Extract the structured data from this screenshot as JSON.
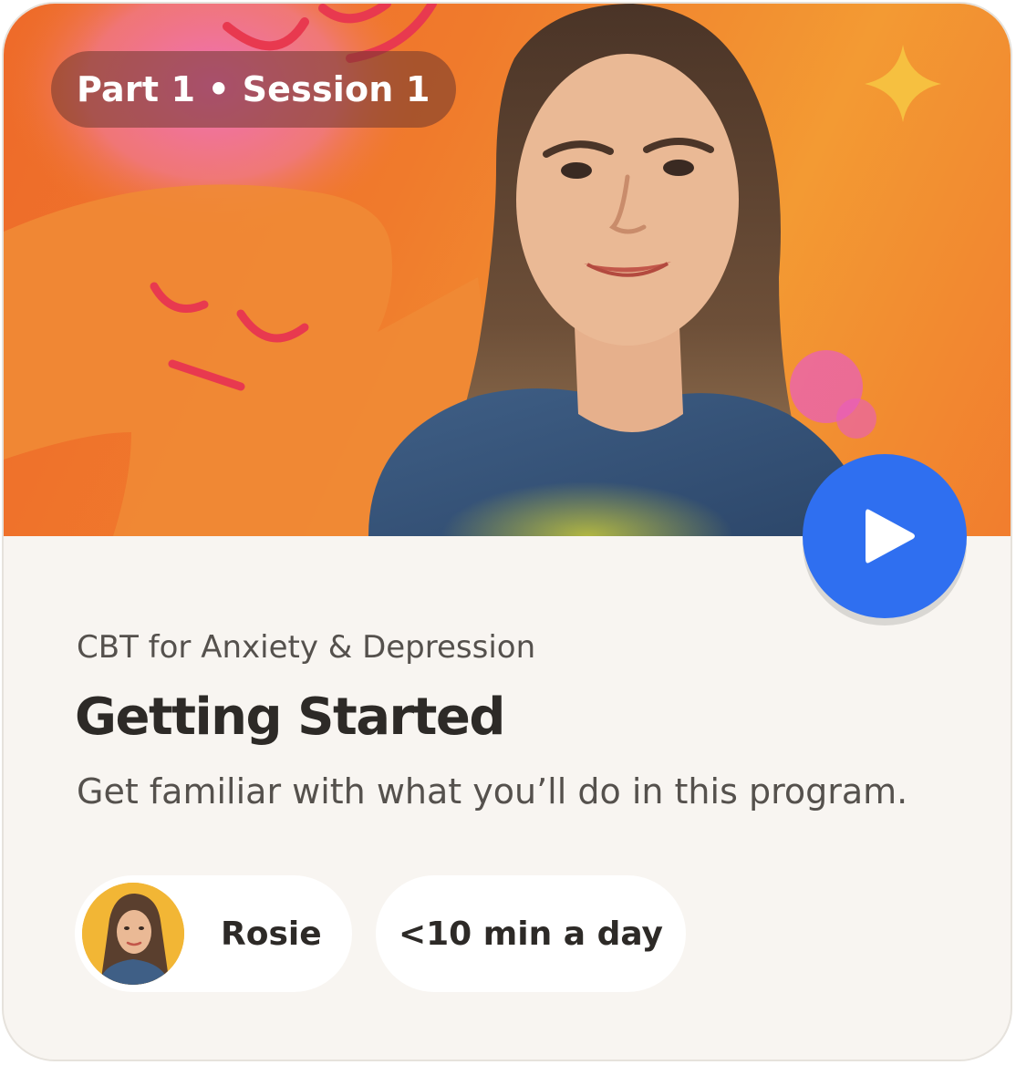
{
  "session_badge": "Part 1 • Session 1",
  "program_name": "CBT for Anxiety & Depression",
  "session_title": "Getting Started",
  "session_description": "Get familiar with what you’ll do in this program.",
  "guide": {
    "name": "Rosie",
    "avatar_icon": "guide-avatar"
  },
  "duration_label": "<10 min a day",
  "play_icon": "play-icon",
  "colors": {
    "hero_orange": "#f07a2c",
    "accent_blue": "#2f6ff0",
    "card_background": "#f8f5f1",
    "sparkle_yellow": "#f6c040",
    "avatar_yellow": "#f2b635"
  }
}
